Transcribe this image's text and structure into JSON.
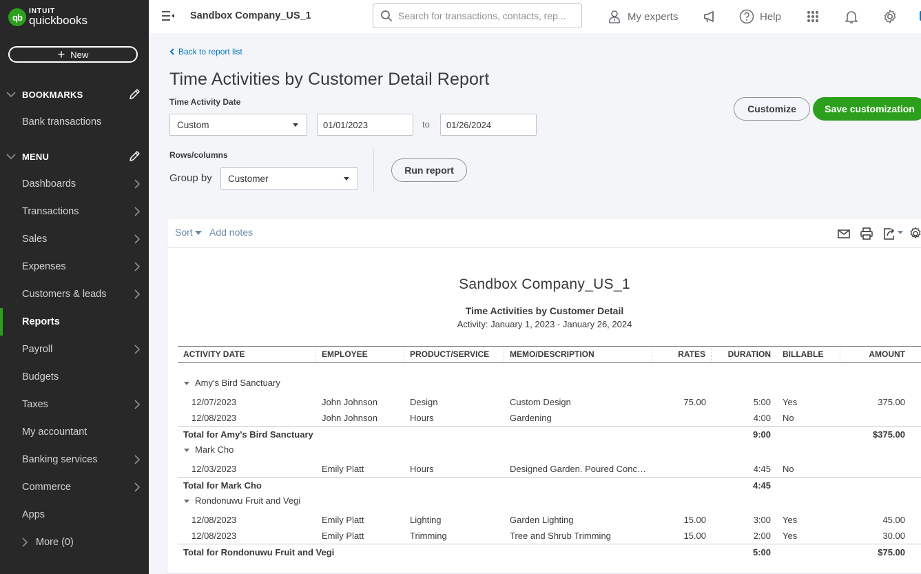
{
  "brand": {
    "logo_mark": "qb",
    "logo_top": "INTUIT",
    "logo_bottom": "quickbooks",
    "accent": "#2ca01c",
    "link": "#0077c5"
  },
  "sidebar": {
    "new_label": "New",
    "bookmarks_label": "BOOKMARKS",
    "bookmarks": [
      {
        "label": "Bank transactions"
      }
    ],
    "menu_label": "MENU",
    "items": [
      {
        "label": "Dashboards",
        "has_arrow": true
      },
      {
        "label": "Transactions",
        "has_arrow": true
      },
      {
        "label": "Sales",
        "has_arrow": true
      },
      {
        "label": "Expenses",
        "has_arrow": true
      },
      {
        "label": "Customers & leads",
        "has_arrow": true
      },
      {
        "label": "Reports",
        "has_arrow": false,
        "active": true
      },
      {
        "label": "Payroll",
        "has_arrow": true
      },
      {
        "label": "Budgets",
        "has_arrow": false
      },
      {
        "label": "Taxes",
        "has_arrow": true
      },
      {
        "label": "My accountant",
        "has_arrow": false
      },
      {
        "label": "Banking services",
        "has_arrow": true
      },
      {
        "label": "Commerce",
        "has_arrow": true
      },
      {
        "label": "Apps",
        "has_arrow": false
      }
    ],
    "more_label": "More (0)"
  },
  "topbar": {
    "company": "Sandbox Company_US_1",
    "search_placeholder": "Search for transactions, contacts, rep...",
    "my_experts": "My experts",
    "help": "Help",
    "icons": [
      "menu-toggle-icon",
      "search-icon",
      "person-icon",
      "megaphone-icon",
      "help-icon",
      "apps-grid-icon",
      "bell-icon",
      "gear-icon"
    ]
  },
  "page": {
    "back_link": "Back to report list",
    "title": "Time Activities by Customer Detail Report",
    "date_label": "Time Activity Date",
    "date_range_option": "Custom",
    "date_from": "01/01/2023",
    "to_label": "to",
    "date_to": "01/26/2024",
    "rows_columns_label": "Rows/columns",
    "group_by_label": "Group by",
    "group_by_value": "Customer",
    "run_report": "Run report",
    "customize": "Customize",
    "save_customization": "Save customization"
  },
  "report": {
    "toolbar": {
      "sort": "Sort",
      "add_notes": "Add notes",
      "icons": [
        "email-icon",
        "print-icon",
        "export-icon",
        "settings-gear-icon"
      ]
    },
    "company": "Sandbox Company_US_1",
    "title": "Time Activities by Customer Detail",
    "range": "Activity: January 1, 2023 - January 26, 2024",
    "columns": [
      "ACTIVITY DATE",
      "EMPLOYEE",
      "PRODUCT/SERVICE",
      "MEMO/DESCRIPTION",
      "RATES",
      "DURATION",
      "BILLABLE",
      "AMOUNT"
    ],
    "groups": [
      {
        "name": "Amy's Bird Sanctuary",
        "rows": [
          {
            "date": "12/07/2023",
            "employee": "John Johnson",
            "product": "Design",
            "memo": "Custom Design",
            "rate": "75.00",
            "duration": "5:00",
            "billable": "Yes",
            "amount": "375.00"
          },
          {
            "date": "12/08/2023",
            "employee": "John Johnson",
            "product": "Hours",
            "memo": "Gardening",
            "rate": "",
            "duration": "4:00",
            "billable": "No",
            "amount": ""
          }
        ],
        "total_label": "Total for Amy's Bird Sanctuary",
        "total_duration": "9:00",
        "total_amount": "$375.00"
      },
      {
        "name": "Mark Cho",
        "rows": [
          {
            "date": "12/03/2023",
            "employee": "Emily Platt",
            "product": "Hours",
            "memo": "Designed Garden. Poured Concr...",
            "rate": "",
            "duration": "4:45",
            "billable": "No",
            "amount": ""
          }
        ],
        "total_label": "Total for Mark Cho",
        "total_duration": "4:45",
        "total_amount": ""
      },
      {
        "name": "Rondonuwu Fruit and Vegi",
        "rows": [
          {
            "date": "12/08/2023",
            "employee": "Emily Platt",
            "product": "Lighting",
            "memo": "Garden Lighting",
            "rate": "15.00",
            "duration": "3:00",
            "billable": "Yes",
            "amount": "45.00"
          },
          {
            "date": "12/08/2023",
            "employee": "Emily Platt",
            "product": "Trimming",
            "memo": "Tree and Shrub Trimming",
            "rate": "15.00",
            "duration": "2:00",
            "billable": "Yes",
            "amount": "30.00"
          }
        ],
        "total_label": "Total for Rondonuwu Fruit and Vegi",
        "total_duration": "5:00",
        "total_amount": "$75.00"
      }
    ]
  }
}
